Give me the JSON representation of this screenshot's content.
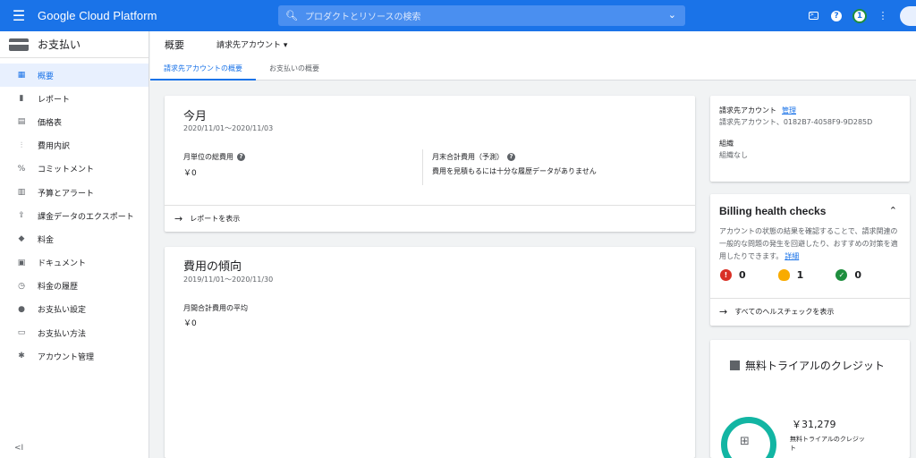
{
  "topbar": {
    "brand": "Google Cloud Platform",
    "search_placeholder": "プロダクトとリソースの検索",
    "notification_count": "1"
  },
  "sidebar": {
    "title": "お支払い",
    "items": [
      {
        "label": "概要",
        "icon": "dashboard-icon"
      },
      {
        "label": "レポート",
        "icon": "bar-chart-icon"
      },
      {
        "label": "価格表",
        "icon": "table-icon"
      },
      {
        "label": "費用内訳",
        "icon": "breakdown-icon"
      },
      {
        "label": "コミットメント",
        "icon": "percent-icon"
      },
      {
        "label": "予算とアラート",
        "icon": "budget-icon"
      },
      {
        "label": "課金データのエクスポート",
        "icon": "upload-icon"
      },
      {
        "label": "料金",
        "icon": "tag-icon"
      },
      {
        "label": "ドキュメント",
        "icon": "document-icon"
      },
      {
        "label": "料金の履歴",
        "icon": "history-icon"
      },
      {
        "label": "お支払い設定",
        "icon": "person-icon"
      },
      {
        "label": "お支払い方法",
        "icon": "credit-card-icon"
      },
      {
        "label": "アカウント管理",
        "icon": "gear-icon"
      }
    ],
    "collapse_glyph": "<I"
  },
  "header": {
    "title": "概要",
    "account_selector": "請求先アカウント"
  },
  "tabs": [
    {
      "label": "請求先アカウントの概要"
    },
    {
      "label": "お支払いの概要"
    }
  ],
  "this_month": {
    "title": "今月",
    "range": "2020/11/01～2020/11/03",
    "total_label": "月単位の総費用",
    "total_value": "￥0",
    "forecast_label": "月末合計費用（予測）",
    "forecast_note": "費用を見積もるには十分な履歴データがありません",
    "report_link": "レポートを表示"
  },
  "trend": {
    "title": "費用の傾向",
    "range": "2019/11/01～2020/11/30",
    "avg_label": "月間合計費用の平均",
    "avg_value": "￥0"
  },
  "account_info": {
    "label": "請求先アカウント",
    "manage_link": "管理",
    "account_line": "請求先アカウント、0182B7-4058F9-9D285D",
    "org_label": "組織",
    "org_value": "組織なし"
  },
  "health": {
    "title": "Billing health checks",
    "description": "アカウントの状態の結果を確認することで、請求関連の一般的な問題の発生を回避したり、おすすめの対策を適用したりできます。",
    "detail_link": "詳細",
    "errors": "0",
    "warnings": "1",
    "ok": "0",
    "view_all": "すべてのヘルスチェックを表示"
  },
  "trial": {
    "title": "無料トライアルのクレジット",
    "amount": "￥31,279",
    "amount_label": "無料トライアルのクレジット"
  },
  "colors": {
    "accent": "#1a73e8",
    "error": "#d93025",
    "warning": "#f9ab00",
    "success": "#1e8e3e",
    "ring": "#12b5a3"
  }
}
